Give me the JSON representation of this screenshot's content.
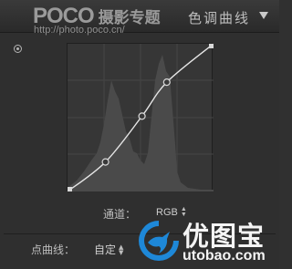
{
  "header": {
    "logo_text": "POCO",
    "logo_sub": "摄影专题",
    "site_url": "http://photo.poco.cn/",
    "panel_title": "色调曲线",
    "collapse_icon": "triangle-down-icon"
  },
  "controls": {
    "target_icon": "target-adjust-icon",
    "channel_label": "通道：",
    "channel_value": "RGB",
    "point_curve_label": "点曲线：",
    "point_curve_value": "自定"
  },
  "watermark": {
    "text": "优图宝",
    "url": "utobao.com",
    "icon": "bird-logo-icon",
    "color": "#1e88d8"
  },
  "curve": {
    "points": [
      [
        0,
        0
      ],
      [
        0.26,
        0.2
      ],
      [
        0.51,
        0.51
      ],
      [
        0.68,
        0.74
      ],
      [
        1,
        1
      ]
    ],
    "line_color": "#e6e6e6"
  }
}
